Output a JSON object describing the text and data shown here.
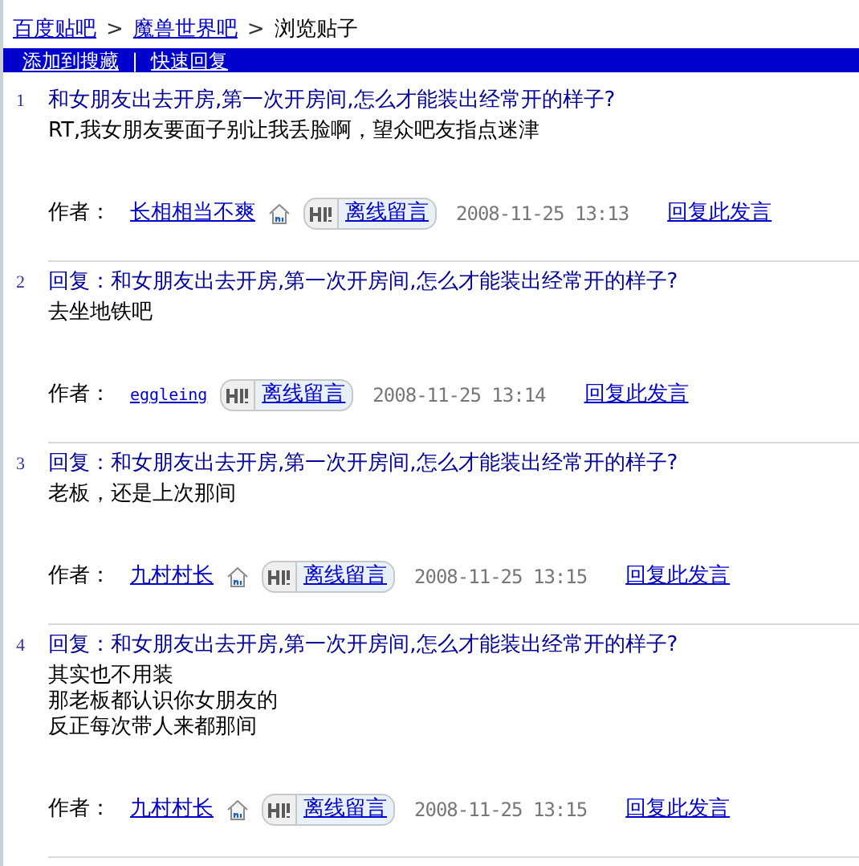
{
  "breadcrumb": [
    {
      "label": "百度贴吧",
      "link": true
    },
    {
      "label": "魔兽世界吧",
      "link": true
    },
    {
      "label": "浏览贴子",
      "link": false
    }
  ],
  "separator": ">",
  "toolbar": [
    "添加到搜藏",
    "快速回复"
  ],
  "toolbar_separator": "|",
  "posts": [
    {
      "number": "1",
      "title": "和女朋友出去开房,第一次开房间,怎么才能装出经常开的样子?",
      "body": [
        "RT,我女朋友要面子别让我丢脸啊，望众吧友指点迷津"
      ],
      "author_label": "作者：",
      "author": "长相相当不爽",
      "kind": "name",
      "space_icon": true,
      "message": "离线留言",
      "time": "2008-11-25 13:13",
      "reply": "回复此发言"
    },
    {
      "number": "2",
      "title": "回复：和女朋友出去开房,第一次开房间,怎么才能装出经常开的样子?",
      "body": [
        "去坐地铁吧"
      ],
      "author_label": "作者：",
      "author": "eggleing",
      "kind": "latin",
      "space_icon": false,
      "message": "离线留言",
      "time": "2008-11-25 13:14",
      "reply": "回复此发言"
    },
    {
      "number": "3",
      "title": "回复：和女朋友出去开房,第一次开房间,怎么才能装出经常开的样子?",
      "body": [
        "老板，还是上次那间"
      ],
      "author_label": "作者：",
      "author": "九村村长",
      "kind": "name",
      "space_icon": true,
      "message": "离线留言",
      "time": "2008-11-25 13:15",
      "reply": "回复此发言"
    },
    {
      "number": "4",
      "title": "回复：和女朋友出去开房,第一次开房间,怎么才能装出经常开的样子?",
      "body": [
        "其实也不用装",
        "那老板都认识你女朋友的",
        "反正每次带人来都那间"
      ],
      "author_label": "作者：",
      "author": "九村村长",
      "kind": "name",
      "space_icon": true,
      "message": "离线留言",
      "time": "2008-11-25 13:15",
      "reply": "回复此发言"
    }
  ]
}
